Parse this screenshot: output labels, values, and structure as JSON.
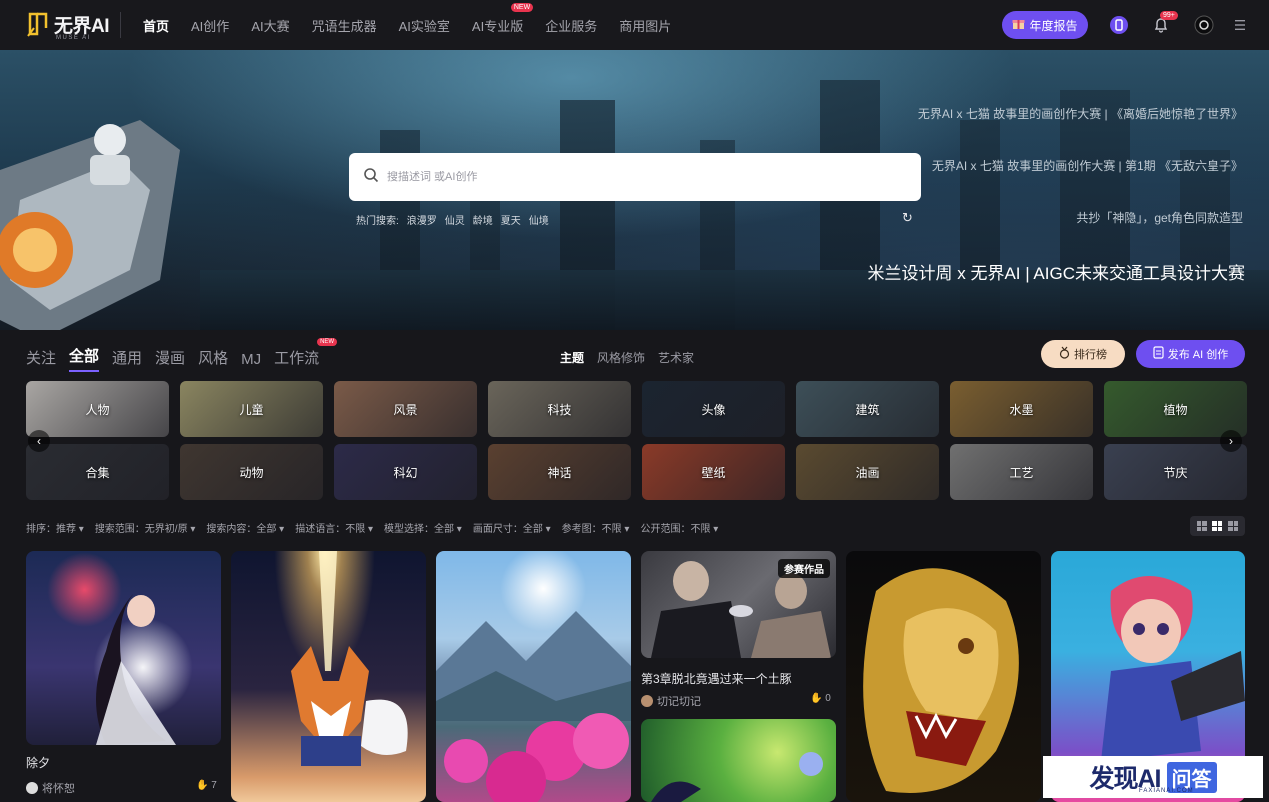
{
  "header": {
    "logo_text": "无界AI",
    "logo_sub": "MUSE AI",
    "nav": [
      {
        "label": "首页",
        "active": true
      },
      {
        "label": "AI创作"
      },
      {
        "label": "AI大赛"
      },
      {
        "label": "咒语生成器"
      },
      {
        "label": "AI实验室"
      },
      {
        "label": "AI专业版",
        "badge": "NEW"
      },
      {
        "label": "企业服务"
      },
      {
        "label": "商用图片"
      }
    ],
    "annual_report": "年度报告",
    "notification_badge": "99+"
  },
  "hero": {
    "search_placeholder": "搜描述词 或AI创作",
    "hot_label": "热门搜索:",
    "hot_terms": [
      "浪漫罗",
      "仙灵",
      "龄境",
      "夏天",
      "仙境"
    ],
    "promos": [
      "无界AI x 七猫 故事里的画创作大赛 | 《离婚后她惊艳了世界》",
      "无界AI x 七猫 故事里的画创作大赛 | 第1期 《无敌六皇子》",
      "共抄「神隐」，get角色同款造型"
    ],
    "promo_main": "米兰设计周 x 无界AI | AIGC未来交通工具设计大赛"
  },
  "category_tabs": [
    {
      "label": "关注"
    },
    {
      "label": "全部",
      "active": true
    },
    {
      "label": "通用"
    },
    {
      "label": "漫画"
    },
    {
      "label": "风格"
    },
    {
      "label": "MJ"
    },
    {
      "label": "工作流",
      "badge": "NEW"
    }
  ],
  "sub_tabs": [
    {
      "label": "主题",
      "active": true
    },
    {
      "label": "风格修饰"
    },
    {
      "label": "艺术家"
    }
  ],
  "buttons": {
    "ranking": "排行榜",
    "publish": "发布 AI 创作"
  },
  "tiles": [
    {
      "label": "人物",
      "bg": "#a9a6a3"
    },
    {
      "label": "儿童",
      "bg": "#8a8560"
    },
    {
      "label": "风景",
      "bg": "#7a5a48"
    },
    {
      "label": "科技",
      "bg": "#6a655a"
    },
    {
      "label": "头像",
      "bg": "#1b2430"
    },
    {
      "label": "建筑",
      "bg": "#3d4f58"
    },
    {
      "label": "水墨",
      "bg": "#7a5e30"
    },
    {
      "label": "植物",
      "bg": "#355a2d"
    },
    {
      "label": "合集",
      "bg": "#2a2c32"
    },
    {
      "label": "动物",
      "bg": "#3f3630"
    },
    {
      "label": "科幻",
      "bg": "#2c2a48"
    },
    {
      "label": "神话",
      "bg": "#5a4030"
    },
    {
      "label": "壁纸",
      "bg": "#8a3a28"
    },
    {
      "label": "油画",
      "bg": "#5a4a30"
    },
    {
      "label": "工艺",
      "bg": "#707070"
    },
    {
      "label": "节庆",
      "bg": "#3a4050"
    }
  ],
  "filters": [
    "排序：推荐",
    "搜索范围：无界初/原",
    "搜索内容：全部",
    "描述语言：不限",
    "模型选择：全部",
    "画面尺寸：全部",
    "参考图：不限",
    "公开范围：不限"
  ],
  "cards": [
    {
      "title": "除夕",
      "author": "将怀恕",
      "likes": "7"
    },
    {
      "title": "第3章脱北竟遇过来一个土豚",
      "author": "切记切记",
      "likes": "0",
      "tag": "参赛作品"
    }
  ],
  "watermark": {
    "main": "发现AI",
    "box": "问答",
    "sub": "FAXIANAI.COM"
  }
}
